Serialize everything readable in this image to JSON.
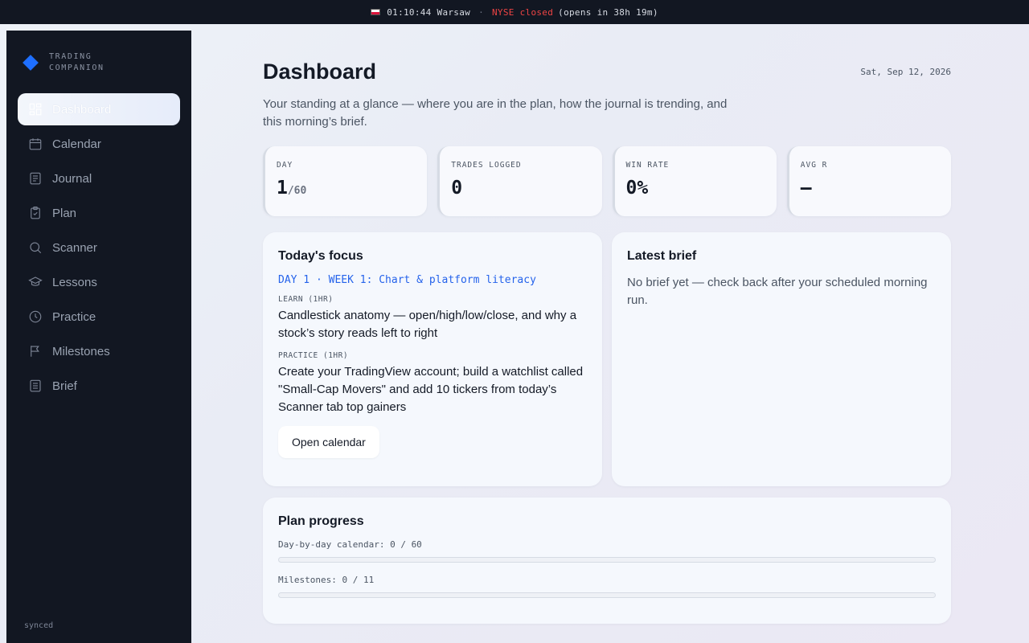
{
  "topbar": {
    "time": "01:10:44 Warsaw",
    "separator": "·",
    "market_status": "NYSE closed",
    "opens_in": "(opens in 38h 19m)"
  },
  "brand": {
    "line1": "TRADING",
    "line2": "COMPANION"
  },
  "sidebar": {
    "items": [
      {
        "label": "Dashboard",
        "icon": "dashboard-icon",
        "active": true
      },
      {
        "label": "Calendar",
        "icon": "calendar-icon"
      },
      {
        "label": "Journal",
        "icon": "journal-icon"
      },
      {
        "label": "Plan",
        "icon": "clipboard-check-icon"
      },
      {
        "label": "Scanner",
        "icon": "search-icon"
      },
      {
        "label": "Lessons",
        "icon": "graduation-cap-icon"
      },
      {
        "label": "Practice",
        "icon": "clock-icon"
      },
      {
        "label": "Milestones",
        "icon": "flag-icon"
      },
      {
        "label": "Brief",
        "icon": "document-icon"
      }
    ],
    "status": "synced"
  },
  "header": {
    "title": "Dashboard",
    "date": "Sat, Sep 12, 2026",
    "subtitle": "Your standing at a glance — where you are in the plan, how the journal is trending, and this morning’s brief."
  },
  "stats": [
    {
      "label": "DAY",
      "value": "1",
      "sub": "/60"
    },
    {
      "label": "TRADES LOGGED",
      "value": "0",
      "sub": ""
    },
    {
      "label": "WIN RATE",
      "value": "0%",
      "sub": ""
    },
    {
      "label": "AVG R",
      "value": "—",
      "sub": ""
    }
  ],
  "focus": {
    "title": "Today's focus",
    "week": "DAY 1 · WEEK 1: Chart & platform literacy",
    "learn_label": "LEARN (1HR)",
    "learn_text": "Candlestick anatomy — open/high/low/close, and why a stock’s story reads left to right",
    "practice_label": "PRACTICE (1HR)",
    "practice_text": "Create your TradingView account; build a watchlist called \"Small-Cap Movers\" and add 10 tickers from today’s Scanner tab top gainers",
    "button": "Open calendar"
  },
  "brief": {
    "title": "Latest brief",
    "text": "No brief yet — check back after your scheduled morning run."
  },
  "progress": {
    "title": "Plan progress",
    "calendar_label": "Day-by-day calendar: 0 / 60",
    "calendar_fraction": 0,
    "milestones_label": "Milestones: 0 / 11",
    "milestones_fraction": 0
  },
  "colors": {
    "accent": "#2563eb",
    "brand": "#1e6fff",
    "closed": "#ef4444",
    "sidebar_bg": "#121722"
  }
}
